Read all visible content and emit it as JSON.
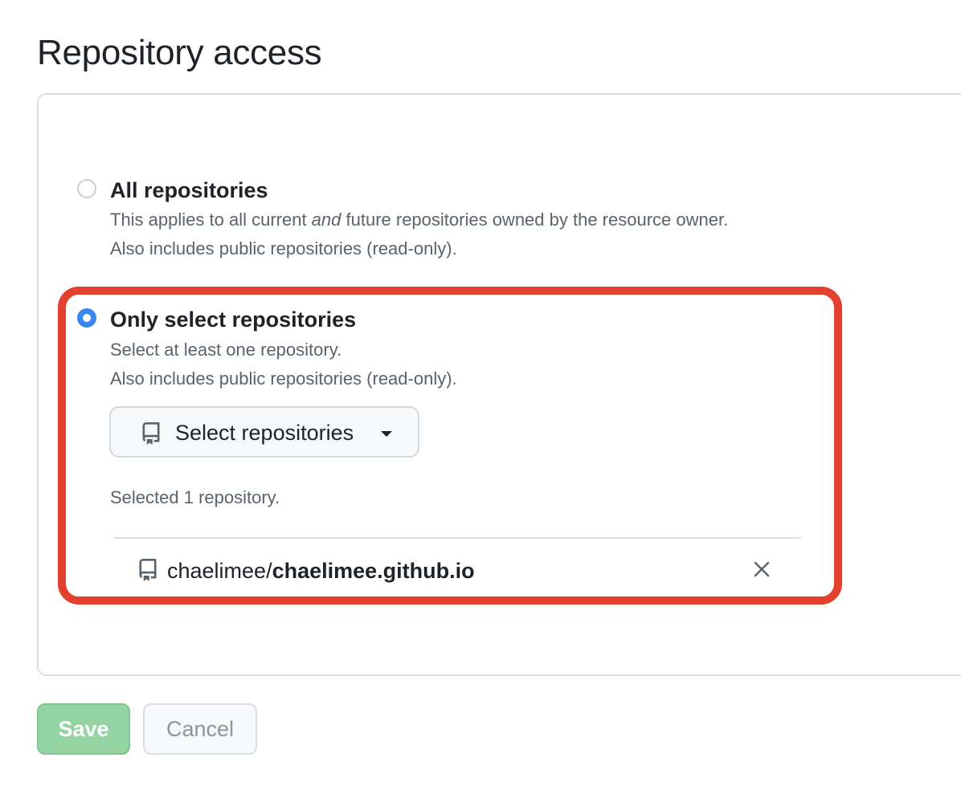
{
  "page": {
    "title": "Repository access"
  },
  "options": {
    "all": {
      "label": "All repositories",
      "desc_line1_before": "This applies to all current ",
      "desc_line1_em": "and",
      "desc_line1_after": " future repositories owned by the resource owner.",
      "desc_line2": "Also includes public repositories (read-only).",
      "selected": false
    },
    "select": {
      "label": "Only select repositories",
      "desc_line1": "Select at least one repository.",
      "desc_line2": "Also includes public repositories (read-only).",
      "selected": true
    }
  },
  "select_button": {
    "label": "Select repositories",
    "icon": "repo-icon",
    "caret_icon": "caret-down-icon"
  },
  "selection": {
    "summary": "Selected 1 repository.",
    "repos": [
      {
        "owner": "chaelimee/",
        "name": "chaelimee.github.io",
        "icon": "repo-icon",
        "remove_icon": "close-icon"
      }
    ]
  },
  "actions": {
    "save_label": "Save",
    "cancel_label": "Cancel"
  },
  "colors": {
    "radio_checked": "#3a86f0",
    "highlight_border": "#e3402d",
    "save_bg": "#94d3a2",
    "muted_text": "#59636e"
  }
}
